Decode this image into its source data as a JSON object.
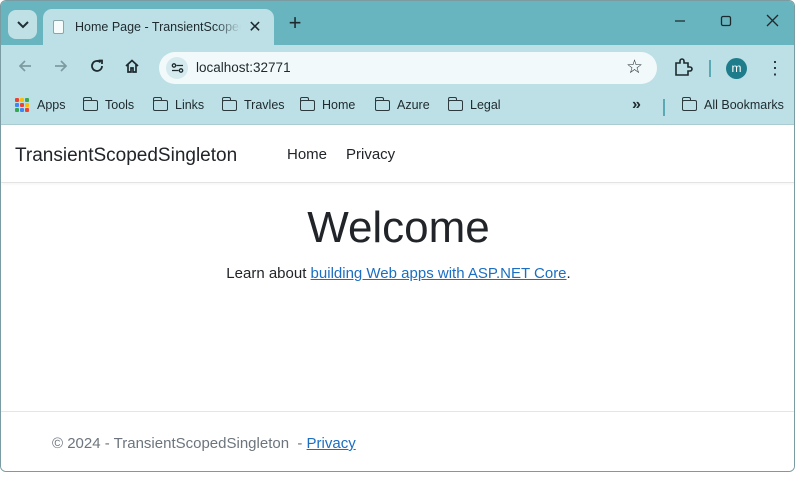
{
  "browser": {
    "tab_title": "Home Page - TransientScopedSingleton",
    "url": "localhost:32771",
    "profile_initial": "m",
    "bookmarks": [
      "Apps",
      "Tools",
      "Links",
      "Travles",
      "Home",
      "Azure",
      "Legal"
    ],
    "all_bookmarks": "All Bookmarks"
  },
  "app": {
    "brand": "TransientScopedSingleton",
    "nav": [
      "Home",
      "Privacy"
    ],
    "heading": "Welcome",
    "learn_prefix": "Learn about ",
    "learn_link": "building Web apps with ASP.NET Core",
    "learn_suffix": ".",
    "footer_text": "© 2024 - TransientScopedSingleton",
    "footer_sep": "  - ",
    "footer_link": "Privacy"
  },
  "colors": {
    "tabstrip": "#68b4bf",
    "toolbar": "#bde0e6",
    "link": "#1b6ec2",
    "avatar": "#1f7d8b"
  },
  "icons": [
    "tab-search-icon",
    "page-icon",
    "close-icon",
    "plus-icon",
    "minimize-icon",
    "maximize-icon",
    "back-icon",
    "forward-icon",
    "reload-icon",
    "home-icon",
    "site-info-icon",
    "star-icon",
    "extensions-icon",
    "more-icon",
    "apps-icon",
    "folder-icon",
    "chevron-double-right-icon"
  ]
}
